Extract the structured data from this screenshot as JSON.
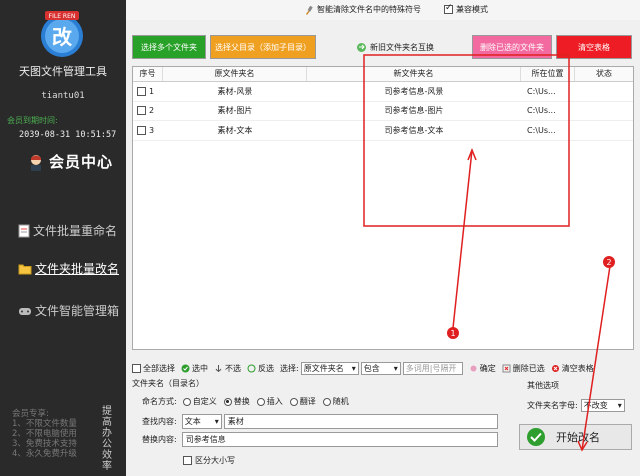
{
  "sidebar": {
    "logo_text": "改",
    "logo_tag": "FILE REN",
    "app_title": "天图文件管理工具",
    "user": "tiantu01",
    "expire_label": "会员到期时间:",
    "expire_date": "2039-08-31 10:51:57",
    "vip_center": "会员中心",
    "nav": [
      {
        "label": "文件批量重命名"
      },
      {
        "label": "文件夹批量改名"
      },
      {
        "label": "文件智能管理箱"
      }
    ],
    "promo_lines": [
      "会员专享:",
      "1、不限文件数量",
      "2、不限电脑使用",
      "3、免费技术支持",
      "4、永久免费升级"
    ],
    "promo_side": "提高办公效率"
  },
  "topbar": {
    "special_chars": "智能清除文件名中的特殊符号",
    "compat_mode": "兼容模式"
  },
  "buttons": {
    "select_multi": "选择多个文件夹",
    "select_parent": "选择父目录（添加子目录）",
    "swap": "新旧文件夹名互换",
    "delete_selected": "删除已选的文件夹",
    "clear_table": "清空表格"
  },
  "table": {
    "headers": [
      "序号",
      "原文件夹名",
      "新文件夹名",
      "所在位置",
      "状态"
    ],
    "rows": [
      {
        "num": "1",
        "orig": "素材-风景",
        "new": "司参考信息-风景",
        "loc": "C:\\Us...",
        "status": ""
      },
      {
        "num": "2",
        "orig": "素材-图片",
        "new": "司参考信息-图片",
        "loc": "C:\\Us...",
        "status": ""
      },
      {
        "num": "3",
        "orig": "素材-文本",
        "new": "司参考信息-文本",
        "loc": "C:\\Us...",
        "status": ""
      }
    ]
  },
  "toolbar": {
    "select_all": "全部选择",
    "select": "选中",
    "unselect": "不选",
    "invert": "反选",
    "choose_label": "选择:",
    "field_select": "原文件夹名",
    "match_select": "包含",
    "placeholder": "多词用|号隔开",
    "confirm": "确定",
    "delete_selected": "删除已选",
    "clear_table": "清空表格"
  },
  "panel": {
    "title": "文件夹名（目录名）",
    "mode_label": "命名方式:",
    "modes": [
      "自定义",
      "替换",
      "插入",
      "翻译",
      "随机"
    ],
    "selected_mode": "替换",
    "find_label": "查找内容:",
    "find_type": "文本",
    "find_value": "素材",
    "replace_label": "替换内容:",
    "replace_value": "司参考信息",
    "case_label": "区分大小写"
  },
  "other": {
    "title": "其他选项",
    "case_label": "文件夹名字母:",
    "case_value": "不改变",
    "start": "开始改名"
  },
  "annotations": {
    "marker1": "1",
    "marker2": "2"
  },
  "colors": {
    "sidebar_bg": "#2a2a2a",
    "btn_green": "#27a127",
    "btn_orange": "#f0a020",
    "btn_pink": "#f26aa0",
    "btn_red": "#ee1c24",
    "annotation_red": "#e02020"
  }
}
